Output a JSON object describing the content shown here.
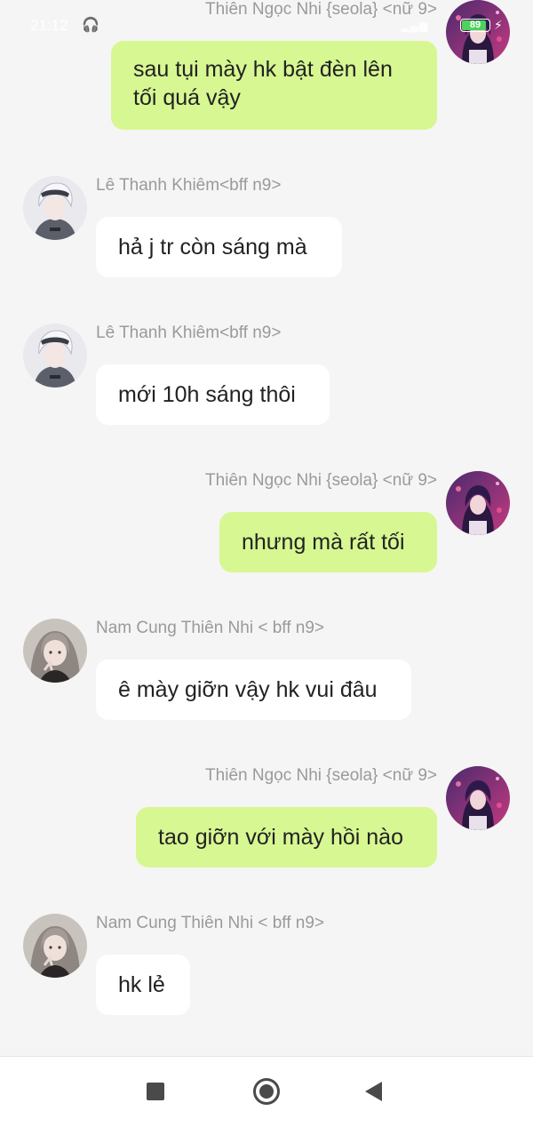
{
  "status_bar": {
    "time": "21:12",
    "battery_level": "89",
    "headphone_icon": "headphones-icon",
    "battery_icon": "battery-icon"
  },
  "messages": [
    {
      "side": "out",
      "sender": "Thiên Ngọc Nhi {seola} <nữ 9>",
      "text": "sau tụi mày hk bật đèn lên tối quá vậy",
      "avatar_icon": "avatar-purple-hair"
    },
    {
      "side": "in",
      "sender": "Lê Thanh Khiêm<bff n9>",
      "text": "hả j tr còn sáng mà",
      "avatar_icon": "avatar-white-hair-boy"
    },
    {
      "side": "in",
      "sender": "Lê Thanh Khiêm<bff n9>",
      "text": "mới 10h sáng thôi",
      "avatar_icon": "avatar-white-hair-boy"
    },
    {
      "side": "out",
      "sender": "Thiên Ngọc Nhi {seola} <nữ 9>",
      "text": "nhưng mà rất tối",
      "avatar_icon": "avatar-purple-hair"
    },
    {
      "side": "in",
      "sender": "Nam Cung Thiên Nhi < bff n9>",
      "text": "ê mày giỡn vậy hk vui đâu",
      "avatar_icon": "avatar-grey-hair-girl"
    },
    {
      "side": "out",
      "sender": "Thiên Ngọc Nhi {seola} <nữ 9>",
      "text": "tao giỡn với mày hồi nào",
      "avatar_icon": "avatar-purple-hair"
    },
    {
      "side": "in",
      "sender": "Nam Cung Thiên Nhi < bff n9>",
      "text": "hk lẻ",
      "avatar_icon": "avatar-grey-hair-girl"
    }
  ],
  "nav_bar": {
    "recents_icon": "square-recents-icon",
    "home_icon": "circle-home-icon",
    "back_icon": "triangle-back-icon"
  },
  "colors": {
    "background": "#f5f5f5",
    "incoming_bubble": "#ffffff",
    "outgoing_bubble": "#d7f792",
    "sender_name": "#9a9a9a",
    "message_text": "#222222"
  }
}
